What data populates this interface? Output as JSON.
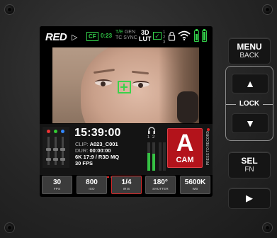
{
  "top_bar": {
    "brand": "RED",
    "media_badge": "CF",
    "media_time": "0:23",
    "te_tc_rows": [
      {
        "label": "T/E",
        "value": "GEN"
      },
      {
        "label": "TC",
        "value": "SYNC"
      }
    ],
    "lut": "3D LUT",
    "lut_line1": "3D",
    "lut_line2": "LUT",
    "status_numbers": [
      "1",
      "2",
      "3"
    ],
    "accent_color": "#33d04a"
  },
  "clip_info": {
    "timecode": "15:39:00",
    "clip_label": "CLIP:",
    "clip_value": "A023_C001",
    "dur_label": "DUR:",
    "dur_value": "00:00:00",
    "format": "6K 17:9 / R3D MQ",
    "fps": "30 FPS"
  },
  "audio": {
    "channel_labels": [
      "1",
      "2"
    ],
    "levels": [
      0.62,
      0.6
    ]
  },
  "camera": {
    "letter": "A",
    "label": "CAM",
    "record_hint": "PRESS TO RECORD",
    "color": "#b3131b"
  },
  "settings": [
    {
      "value": "30",
      "label": "FPS"
    },
    {
      "value": "800",
      "label": "ISO"
    },
    {
      "value": "1/4",
      "label": "IRIS"
    },
    {
      "value": "180°",
      "label": "SHUTTER"
    },
    {
      "value": "5600K",
      "label": "WB"
    }
  ],
  "hardware_buttons": {
    "menu": "MENU",
    "back": "BACK",
    "up_icon": "up-arrow-icon",
    "lock": "LOCK",
    "down_icon": "down-arrow-icon",
    "sel": "SEL",
    "fn": "FN",
    "play_icon": "play-icon"
  }
}
